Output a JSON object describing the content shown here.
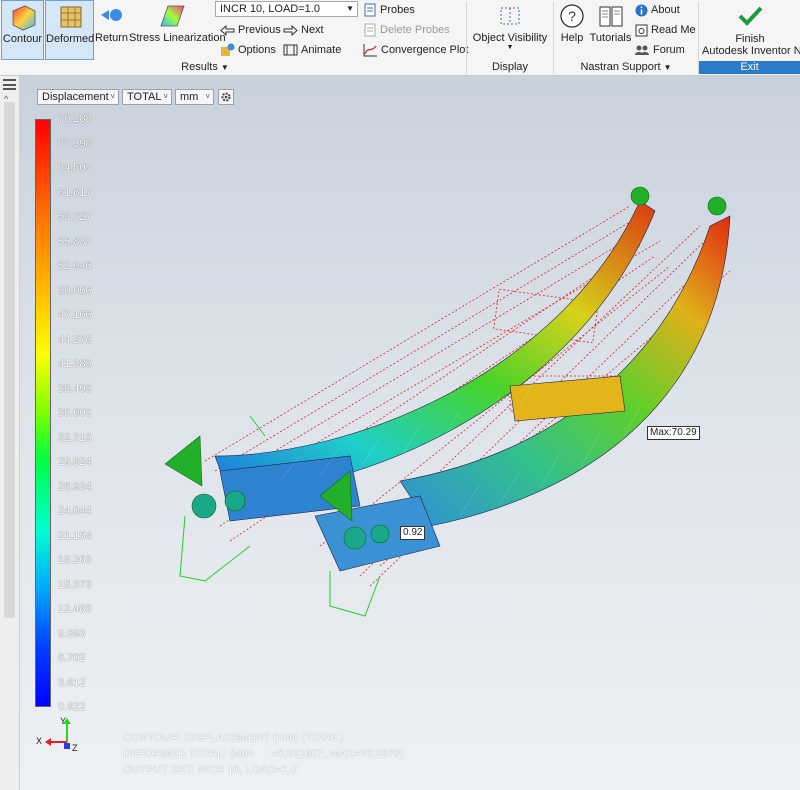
{
  "ribbon": {
    "contour_label": "Contour",
    "deformed_label": "Deformed",
    "return_label": "Return",
    "stress_linearization_label": "Stress Linearization",
    "step_select_value": "INCR 10, LOAD=1.0",
    "previous_label": "Previous",
    "next_label": "Next",
    "options_label": "Options",
    "animate_label": "Animate",
    "probes_label": "Probes",
    "delete_probes_label": "Delete Probes",
    "convergence_plot_label": "Convergence Plot",
    "results_group_label": "Results",
    "object_visibility_label": "Object Visibility",
    "display_group_label": "Display",
    "help_label": "Help",
    "tutorials_label": "Tutorials",
    "about_label": "About",
    "read_me_label": "Read Me",
    "forum_label": "Forum",
    "nastran_support_group_label": "Nastran Support",
    "finish_label_line1": "Finish",
    "finish_label_line2": "Autodesk Inventor Nas",
    "exit_group_label": "Exit"
  },
  "viewport": {
    "result_type": "Displacement",
    "component": "TOTAL",
    "units": "mm",
    "legend_values": [
      "70.288",
      "67.398",
      "64.507",
      "61.617",
      "58.727",
      "55.837",
      "52.946",
      "50.056",
      "47.166",
      "44.276",
      "41.385",
      "38.495",
      "35.605",
      "32.715",
      "29.824",
      "26.934",
      "24.044",
      "21.154",
      "18.263",
      "15.373",
      "12.483",
      "9.593",
      "6.702",
      "3.812",
      "0.922"
    ],
    "max_label": "Max:70.29",
    "min_label": "0.92",
    "info_line1": "CONTOUR: DISPLACEMENT (mm) (TOTAL)",
    "info_line2": "DEFORMED TOTAL: (MIN      =0.921907, MAX=70.2878)",
    "info_line3": "OUTPUT SET: INCR 10, LOAD=1.0",
    "triad_x": "X",
    "triad_y": "Y",
    "triad_z": "Z"
  },
  "colors": {
    "accent": "#2b7bcb",
    "contour_max": "#ff0000",
    "contour_min": "#0000ff",
    "constraint": "#22aa22"
  }
}
